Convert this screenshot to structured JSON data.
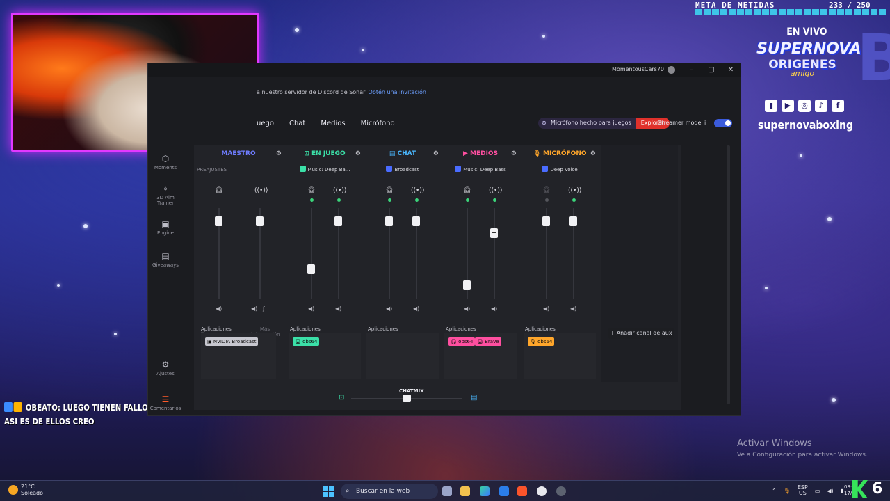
{
  "overlay": {
    "meta_label": "META DE METIDAS",
    "meta_count": "233 / 250",
    "live": "EN VIVO",
    "brand_line1": "SUPERNOVA",
    "brand_line2": "ORIGENES",
    "brand_line3": "amigo",
    "handle": "supernovaboxing",
    "chat_user": "OBEATO:",
    "chat_message1": "LUEGO TIENEN FALLOS",
    "chat_message2": "ASI ES DE ELLOS CREO",
    "watermark_title": "Activar Windows",
    "watermark_sub": "Ve a Configuración para activar Windows.",
    "corner_number": "6",
    "socials": [
      "twitch-icon",
      "youtube-icon",
      "instagram-icon",
      "tiktok-icon",
      "facebook-icon"
    ]
  },
  "app": {
    "user": "MomentousCars70",
    "notice": "a nuestro servidor de Discord de Sonar",
    "notice_link": "Obtén una invitación",
    "tabs": [
      "Juego",
      "Chat",
      "Medios",
      "Micrófono"
    ],
    "tab_partial": "uego",
    "mic_ad": "Micrófono hecho para juegos",
    "mic_ad_link": "Explorar",
    "streamer_mode": "Streamer mode",
    "streamer_mode_on": true,
    "info": "i",
    "rail": [
      {
        "label": "Moments",
        "icon": "moments-icon"
      },
      {
        "label": "3D Aim Trainer",
        "icon": "aim-trainer-icon"
      },
      {
        "label": "Engine",
        "icon": "engine-icon"
      },
      {
        "label": "Giveaways",
        "icon": "gift-icon"
      },
      {
        "label": "Ajustes",
        "icon": "gear-icon"
      },
      {
        "label": "Comentarios",
        "icon": "feedback-icon"
      }
    ],
    "channels": [
      {
        "id": "maestro",
        "name": "MAESTRO",
        "color": "#6f7dff",
        "preset": "PREAJUSTES",
        "apps_label": "Aplicaciones listas para enrutamiento",
        "apps_more": "Más información",
        "apps": [
          {
            "name": "NVIDIA Broadcast",
            "color": "#c7c7cf"
          }
        ],
        "left_level": 0.9,
        "right_level": 0.9
      },
      {
        "id": "juego",
        "name": "EN JUEGO",
        "color": "#3be0a8",
        "preset": "Music: Deep Ba...",
        "apps_label": "Aplicaciones",
        "apps": [
          {
            "name": "obs64",
            "color": "#3be0a8"
          }
        ],
        "left_level": 0.3,
        "right_level": 0.9
      },
      {
        "id": "chat",
        "name": "CHAT",
        "color": "#4ab8ff",
        "preset": "Broadcast",
        "apps_label": "Aplicaciones",
        "apps": [],
        "left_level": 0.9,
        "right_level": 0.9
      },
      {
        "id": "medios",
        "name": "MEDIOS",
        "color": "#ff4fa0",
        "preset": "Music: Deep Bass",
        "apps_label": "Aplicaciones",
        "apps": [
          {
            "name": "obs64",
            "color": "#ff4fa0"
          },
          {
            "name": "Brave",
            "color": "#ff4fa0"
          }
        ],
        "left_level": 0.1,
        "right_level": 0.75
      },
      {
        "id": "mic",
        "name": "MICRÓFONO",
        "color": "#ffa62b",
        "preset": "Deep Voice",
        "apps_label": "Aplicaciones",
        "apps": [
          {
            "name": "obs64",
            "color": "#ffa62b"
          }
        ],
        "left_level": 0.9,
        "right_level": 0.9
      }
    ],
    "add_aux": "Añadir canal de aux",
    "chatmix": "CHATMIX",
    "chatmix_balance": 0.5
  },
  "taskbar": {
    "temp": "21°C",
    "weather": "Soleado",
    "search": "Buscar en la web",
    "lang1": "ESP",
    "lang2": "US",
    "time": "08:...",
    "date": "17/..."
  }
}
